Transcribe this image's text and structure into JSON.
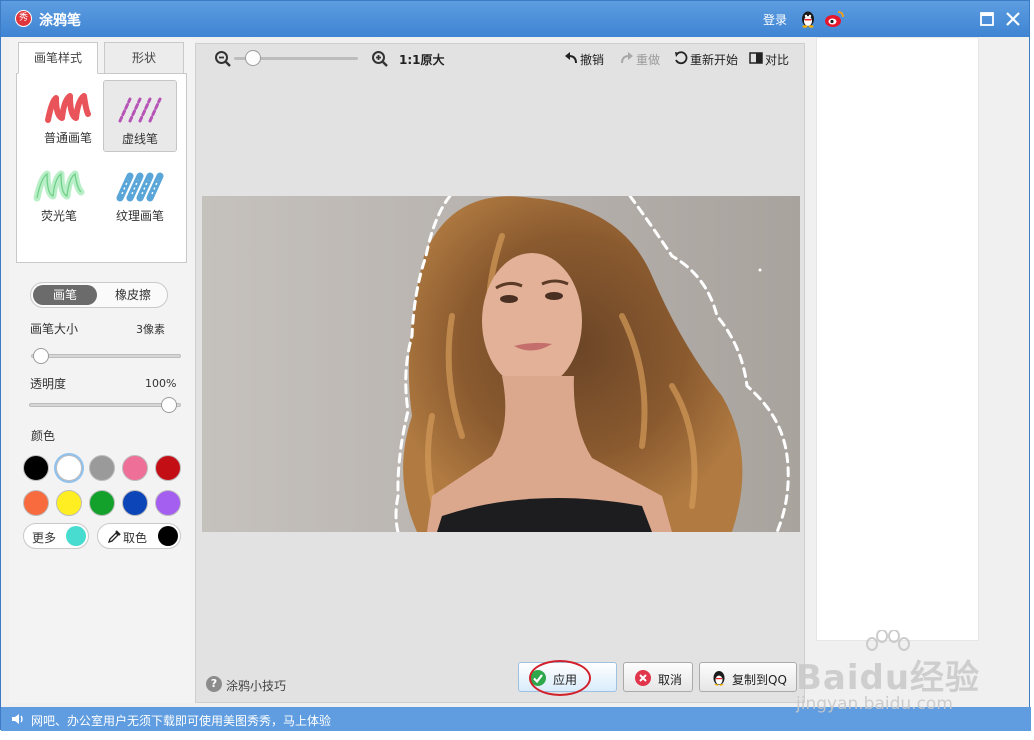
{
  "window": {
    "title": "涂鸦笔",
    "login": "登录"
  },
  "left_panel": {
    "tabs": [
      {
        "label": "画笔样式",
        "active": true
      },
      {
        "label": "形状",
        "active": false
      }
    ],
    "brushes": [
      {
        "label": "普通画笔",
        "icon": "regular-brush-icon",
        "color": "#e9545b"
      },
      {
        "label": "虚线笔",
        "icon": "dashed-brush-icon",
        "color": "#b655b6",
        "selected": true
      },
      {
        "label": "荧光笔",
        "icon": "highlighter-brush-icon",
        "color": "#8fe0a8"
      },
      {
        "label": "纹理画笔",
        "icon": "texture-brush-icon",
        "color": "#5aa6d8"
      }
    ],
    "mode": {
      "brush": "画笔",
      "eraser": "橡皮擦",
      "active": "brush"
    },
    "brush_size": {
      "label": "画笔大小",
      "value": "3像素"
    },
    "opacity": {
      "label": "透明度",
      "value": "100%"
    },
    "colors": {
      "label": "颜色",
      "swatches": [
        "#000000",
        "#ffffff",
        "#9a9a9a",
        "#ee6f98",
        "#c40e16",
        "#f76b3f",
        "#ffee22",
        "#14a12b",
        "#0c45b8",
        "#a45ef0"
      ],
      "selected": "#ffffff",
      "more_label": "更多",
      "more_color": "#48dcd0",
      "picker_label": "取色",
      "picker_color": "#000000"
    }
  },
  "canvas": {
    "zoom_label": "1:1原大",
    "zoom_level": 0.15,
    "tools": {
      "undo": "撤销",
      "redo": "重做",
      "restart": "重新开始",
      "compare": "对比"
    },
    "tip": "涂鸦小技巧",
    "buttons": {
      "apply": "应用",
      "cancel": "取消",
      "copy": "复制到QQ"
    }
  },
  "status_bar": {
    "text": "网吧、办公室用户无须下载即可使用美图秀秀，马上体验"
  },
  "watermark": {
    "main": "Baidu经验",
    "sub": "jingyan.baidu.com"
  }
}
